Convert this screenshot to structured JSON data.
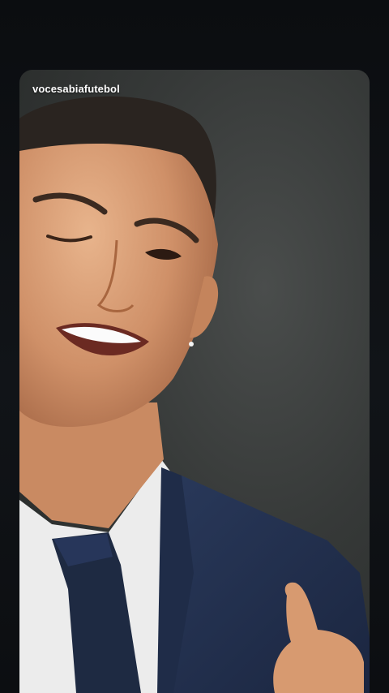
{
  "post": {
    "username": "vocesabiafutebol"
  },
  "colors": {
    "page_background": "#0d0f12",
    "card_background": "#363938",
    "username_text": "#ffffff",
    "suit": "#253350",
    "tie": "#1e2a42",
    "shirt": "#eeeeee",
    "skin": "#d59a72"
  }
}
